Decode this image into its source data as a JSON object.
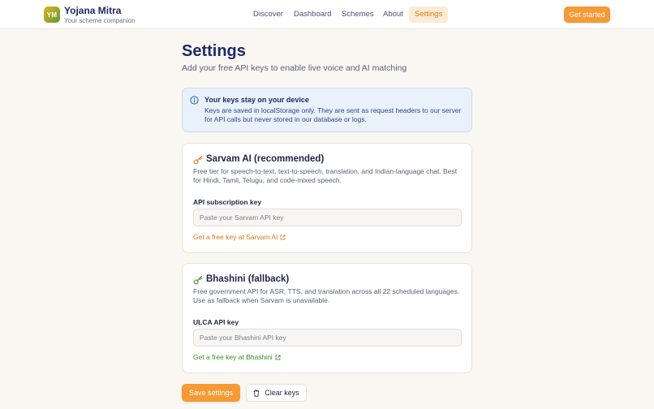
{
  "header": {
    "logo_text": "YM",
    "brand_name": "Yojana Mitra",
    "brand_tagline": "Your scheme companion",
    "nav": [
      {
        "label": "Discover",
        "active": false
      },
      {
        "label": "Dashboard",
        "active": false
      },
      {
        "label": "Schemes",
        "active": false
      },
      {
        "label": "About",
        "active": false
      },
      {
        "label": "Settings",
        "active": true
      }
    ],
    "cta_label": "Get started"
  },
  "page": {
    "title": "Settings",
    "subtitle": "Add your free API keys to enable live voice and AI matching"
  },
  "notice": {
    "icon": "info-icon",
    "title": "Your keys stay on your device",
    "body": "Keys are saved in localStorage only. They are sent as request headers to our server for API calls but never stored in our database or logs."
  },
  "providers": [
    {
      "icon": "key-icon",
      "title": "Sarvam AI (recommended)",
      "description": "Free tier for speech-to-text, text-to-speech, translation, and Indian-language chat. Best for Hindi, Tamil, Telugu, and code-mixed speech.",
      "field_label": "API subscription key",
      "value": "",
      "placeholder": "Paste your Sarvam API key",
      "link_label": "Get a free key at Sarvam AI",
      "link_color": "#d97a16"
    },
    {
      "icon": "key-icon",
      "title": "Bhashini (fallback)",
      "description": "Free government API for ASR, TTS, and translation across all 22 scheduled languages. Use as fallback when Sarvam is unavailable.",
      "field_label": "ULCA API key",
      "value": "",
      "placeholder": "Paste your Bhashini API key",
      "link_label": "Get a free key at Bhashini",
      "link_color": "#3a8a2a"
    }
  ],
  "actions": {
    "save_label": "Save settings",
    "clear_label": "Clear keys"
  },
  "colors": {
    "accent": "#f59a35",
    "brand": "#1f2a6b",
    "sarvam_icon": "#d97a16",
    "bhashini_icon": "#3a8a2a"
  }
}
